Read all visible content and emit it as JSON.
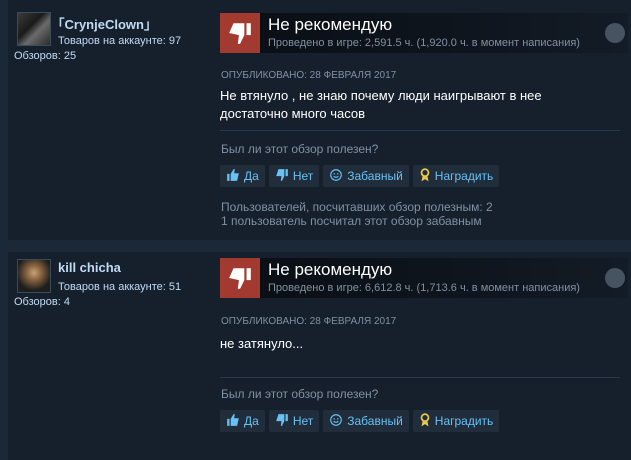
{
  "reviews": [
    {
      "username": "｢CrynjeClown｣",
      "products": "Товаров на аккаунте: 97",
      "reviews_count": "Обзоров: 25",
      "verdict": "Не рекомендую",
      "hours": "Проведено в игре: 2,591.5 ч. (1,920.0 ч. в момент написания)",
      "posted": "Опубликовано: 28 февраля 2017",
      "content_lines": [
        "Не втянуло , не знаю почему люди наигрывают в нее",
        "достаточно много часов"
      ],
      "helpful_question": "Был ли этот обзор полезен?",
      "buttons": {
        "yes": "Да",
        "no": "Нет",
        "funny": "Забавный",
        "award": "Наградить"
      },
      "stats": [
        "Пользователей, посчитавших обзор полезным: 2",
        "1 пользователь посчитал этот обзор забавным"
      ]
    },
    {
      "username": "kill chicha",
      "products": "Товаров на аккаунте: 51",
      "reviews_count": "Обзоров: 4",
      "verdict": "Не рекомендую",
      "hours": "Проведено в игре: 6,612.8 ч. (1,713.6 ч. в момент написания)",
      "posted": "Опубликовано: 28 февраля 2017",
      "content_lines": [
        "не затянуло..."
      ],
      "helpful_question": "Был ли этот обзор полезен?",
      "buttons": {
        "yes": "Да",
        "no": "Нет",
        "funny": "Забавный",
        "award": "Наградить"
      }
    }
  ]
}
